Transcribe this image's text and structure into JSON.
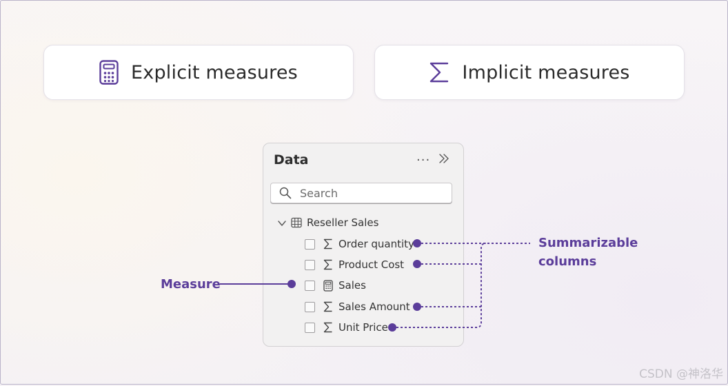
{
  "cards": {
    "explicit": {
      "label": "Explicit measures",
      "icon": "calculator-icon"
    },
    "implicit": {
      "label": "Implicit measures",
      "icon": "sigma-icon"
    }
  },
  "data_pane": {
    "title": "Data",
    "more_icon": "ellipsis-icon",
    "collapse_icon": "double-chevron-right-icon",
    "search": {
      "placeholder": "Search"
    },
    "table": {
      "name": "Reseller Sales",
      "expanded": true
    },
    "fields": [
      {
        "label": "Order quantity",
        "icon": "sigma-icon",
        "checked": false
      },
      {
        "label": "Product Cost",
        "icon": "sigma-icon",
        "checked": false
      },
      {
        "label": "Sales",
        "icon": "calculator-icon",
        "checked": false
      },
      {
        "label": "Sales Amount",
        "icon": "sigma-icon",
        "checked": false
      },
      {
        "label": "Unit Price",
        "icon": "sigma-icon",
        "checked": false
      }
    ]
  },
  "annotations": {
    "measure": "Measure",
    "summarizable_line1": "Summarizable",
    "summarizable_line2": "columns",
    "accent_color": "#5b3d9a"
  },
  "watermark": "CSDN @神洛华"
}
